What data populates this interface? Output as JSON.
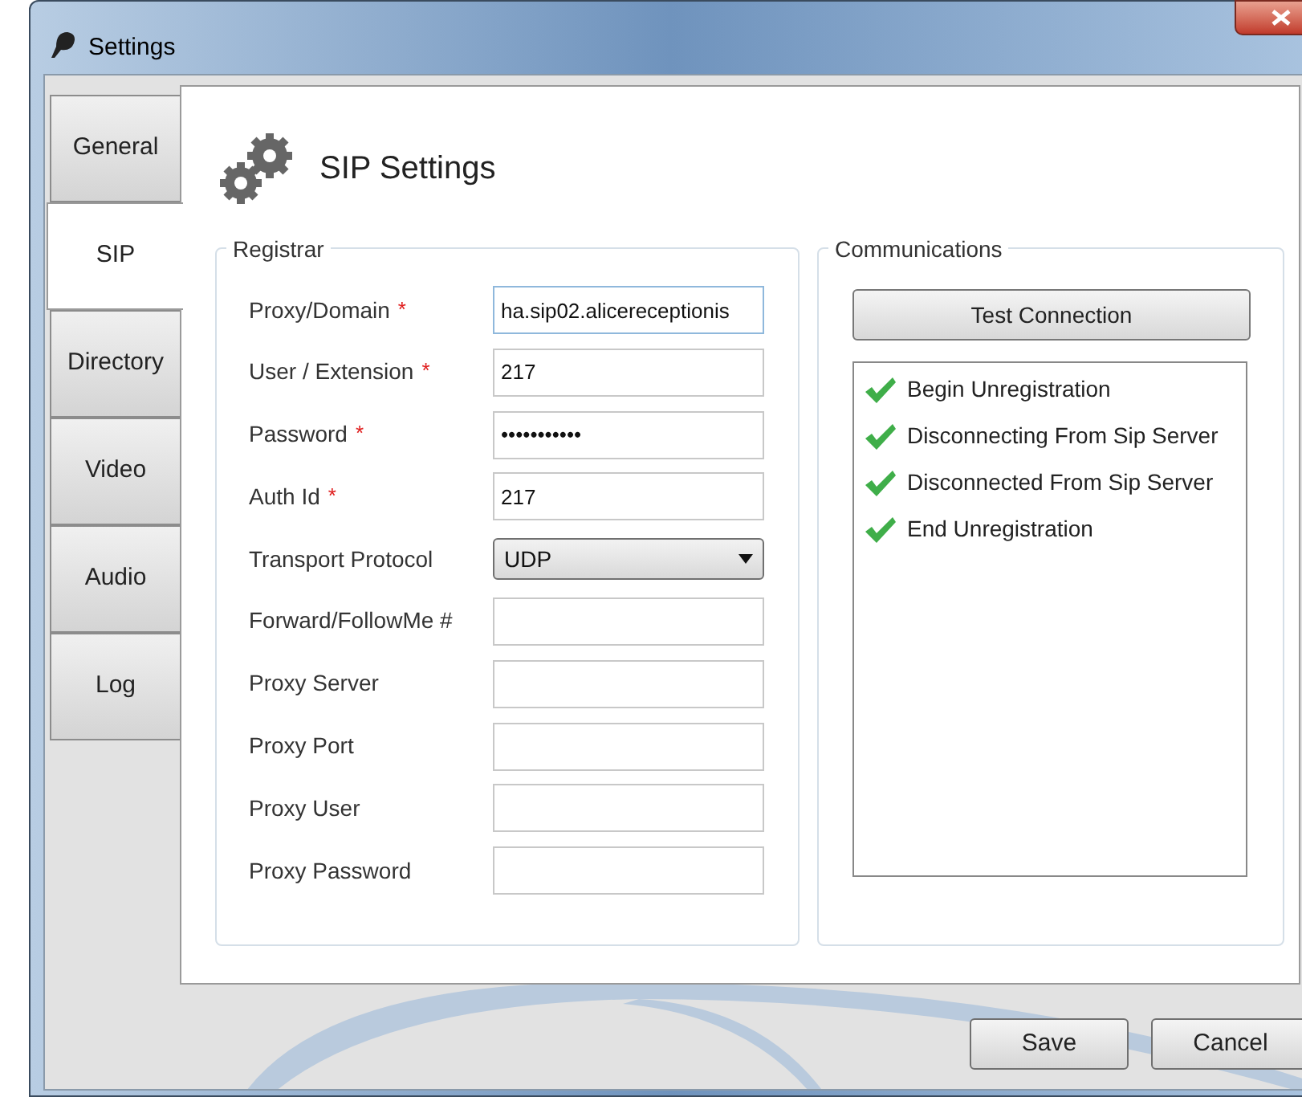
{
  "window": {
    "title": "Settings"
  },
  "tabs": [
    {
      "label": "General",
      "selected": false
    },
    {
      "label": "SIP",
      "selected": true
    },
    {
      "label": "Directory",
      "selected": false
    },
    {
      "label": "Video",
      "selected": false
    },
    {
      "label": "Audio",
      "selected": false
    },
    {
      "label": "Log",
      "selected": false
    }
  ],
  "page_title": "SIP Settings",
  "registrar": {
    "title": "Registrar",
    "fields": [
      {
        "label": "Proxy/Domain",
        "required_mark": "*",
        "kind": "text",
        "value": "ha.sip02.alicereceptionis",
        "focused": true
      },
      {
        "label": "User / Extension",
        "required_mark": "*",
        "kind": "text",
        "value": "217",
        "focused": false
      },
      {
        "label": "Password",
        "required_mark": "*",
        "kind": "text",
        "value": "•••••••••••",
        "focused": false
      },
      {
        "label": "Auth Id",
        "required_mark": "*",
        "kind": "text",
        "value": "217",
        "focused": false
      },
      {
        "label": "Transport Protocol",
        "kind": "select",
        "value": "UDP",
        "focused": false
      },
      {
        "label": "Forward/FollowMe #",
        "kind": "text",
        "focused": false
      },
      {
        "label": "Proxy Server",
        "kind": "text",
        "focused": false
      },
      {
        "label": "Proxy Port",
        "kind": "text",
        "focused": false
      },
      {
        "label": "Proxy User",
        "kind": "text",
        "focused": false
      },
      {
        "label": "Proxy Password",
        "kind": "text",
        "focused": false
      }
    ]
  },
  "communications": {
    "title": "Communications",
    "button": "Test Connection",
    "log": [
      {
        "text": "Begin Unregistration",
        "checked": true
      },
      {
        "text": "Disconnecting From Sip Server",
        "checked": true
      },
      {
        "text": "Disconnected From Sip Server",
        "checked": true
      },
      {
        "text": "End Unregistration",
        "checked": true
      }
    ]
  },
  "buttons": [
    "Save",
    "Cancel"
  ]
}
